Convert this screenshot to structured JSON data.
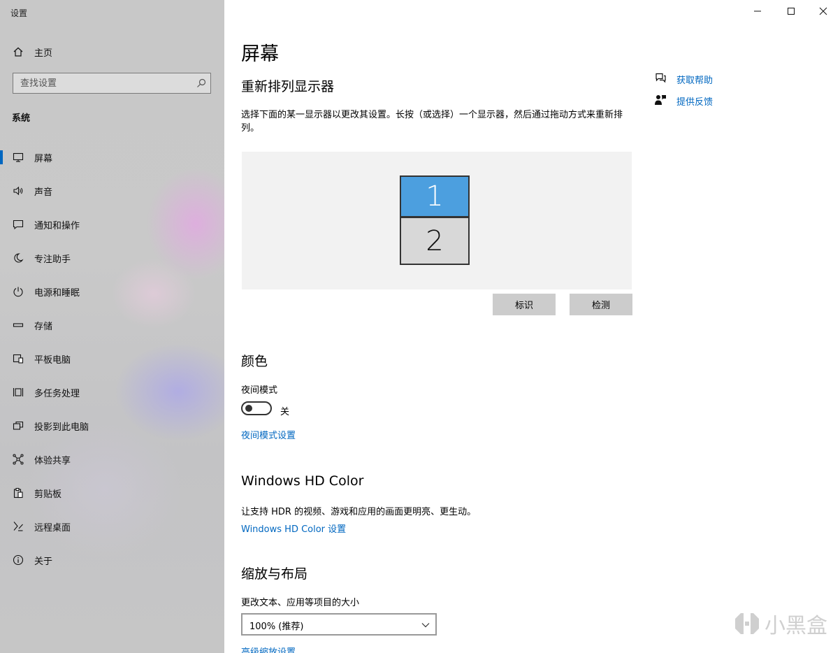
{
  "window": {
    "title": "设置"
  },
  "sidebar": {
    "home_label": "主页",
    "search_placeholder": "查找设置",
    "section_title": "系统",
    "items": [
      {
        "label": "屏幕",
        "icon": "monitor-icon",
        "active": true
      },
      {
        "label": "声音",
        "icon": "speaker-icon"
      },
      {
        "label": "通知和操作",
        "icon": "notification-icon"
      },
      {
        "label": "专注助手",
        "icon": "moon-icon"
      },
      {
        "label": "电源和睡眠",
        "icon": "power-icon"
      },
      {
        "label": "存储",
        "icon": "storage-icon"
      },
      {
        "label": "平板电脑",
        "icon": "tablet-icon"
      },
      {
        "label": "多任务处理",
        "icon": "multitask-icon"
      },
      {
        "label": "投影到此电脑",
        "icon": "project-icon"
      },
      {
        "label": "体验共享",
        "icon": "share-icon"
      },
      {
        "label": "剪贴板",
        "icon": "clipboard-icon"
      },
      {
        "label": "远程桌面",
        "icon": "remote-desktop-icon"
      },
      {
        "label": "关于",
        "icon": "info-icon"
      }
    ]
  },
  "main": {
    "page_title": "屏幕",
    "arrange": {
      "heading": "重新排列显示器",
      "description": "选择下面的某一显示器以更改其设置。长按（或选择）一个显示器，然后通过拖动方式来重新排列。",
      "monitor_1": "1",
      "monitor_2": "2",
      "identify_button": "标识",
      "detect_button": "检测"
    },
    "color": {
      "heading": "颜色",
      "night_mode_label": "夜间模式",
      "toggle_state": "关",
      "night_mode_link": "夜间模式设置"
    },
    "hdr": {
      "heading": "Windows HD Color",
      "description": "让支持 HDR 的视频、游戏和应用的画面更明亮、更生动。",
      "link": "Windows HD Color 设置"
    },
    "scale": {
      "heading": "缩放与布局",
      "label": "更改文本、应用等项目的大小",
      "selected": "100% (推荐)",
      "link": "高级缩放设置"
    }
  },
  "help": {
    "get_help": "获取帮助",
    "feedback": "提供反馈"
  },
  "watermark": "小黑盒",
  "colors": {
    "accent": "#0067c0",
    "monitor_selected": "#4c9fdf"
  }
}
